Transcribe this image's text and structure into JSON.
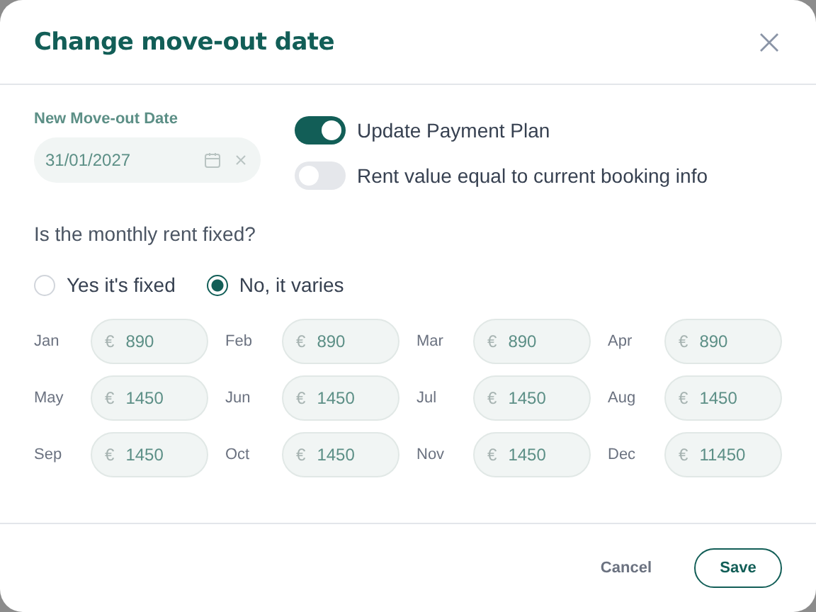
{
  "dialog": {
    "title": "Change move-out date"
  },
  "date_field": {
    "label": "New Move-out Date",
    "value": "31/01/2027"
  },
  "toggles": [
    {
      "label": "Update Payment Plan",
      "on": true
    },
    {
      "label": "Rent value equal to current booking info",
      "on": false
    }
  ],
  "question": "Is the monthly rent fixed?",
  "radios": [
    {
      "label": "Yes it's fixed",
      "selected": false
    },
    {
      "label": "No, it varies",
      "selected": true
    }
  ],
  "months": [
    {
      "label": "Jan",
      "currency": "€",
      "value": "890"
    },
    {
      "label": "Feb",
      "currency": "€",
      "value": "890"
    },
    {
      "label": "Mar",
      "currency": "€",
      "value": "890"
    },
    {
      "label": "Apr",
      "currency": "€",
      "value": "890"
    },
    {
      "label": "May",
      "currency": "€",
      "value": "1450"
    },
    {
      "label": "Jun",
      "currency": "€",
      "value": "1450"
    },
    {
      "label": "Jul",
      "currency": "€",
      "value": "1450"
    },
    {
      "label": "Aug",
      "currency": "€",
      "value": "1450"
    },
    {
      "label": "Sep",
      "currency": "€",
      "value": "1450"
    },
    {
      "label": "Oct",
      "currency": "€",
      "value": "1450"
    },
    {
      "label": "Nov",
      "currency": "€",
      "value": "1450"
    },
    {
      "label": "Dec",
      "currency": "€",
      "value": "11450"
    }
  ],
  "buttons": [
    {
      "label": "Cancel",
      "kind": "text"
    },
    {
      "label": "Save",
      "kind": "outlined"
    }
  ]
}
